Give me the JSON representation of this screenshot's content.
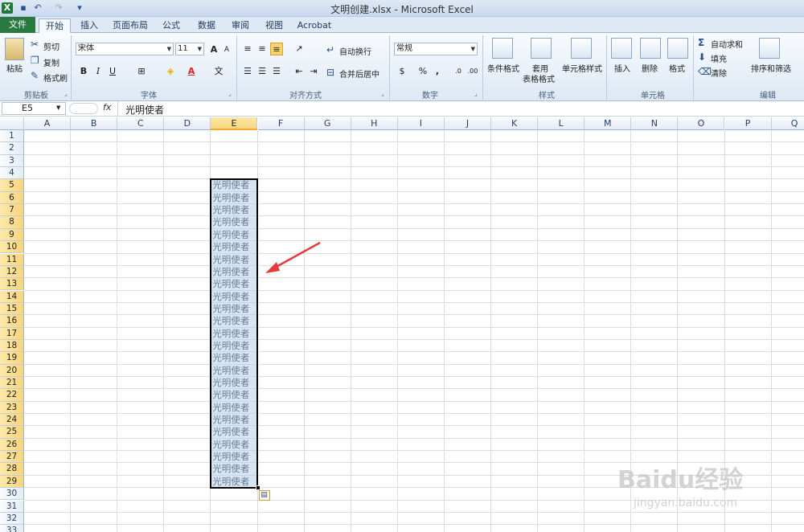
{
  "window": {
    "title": "文明创建.xlsx - Microsoft Excel"
  },
  "tabs": [
    "文件",
    "开始",
    "插入",
    "页面布局",
    "公式",
    "数据",
    "审阅",
    "视图",
    "Acrobat"
  ],
  "ribbon": {
    "clipboard": {
      "paste": "粘贴",
      "cut": "剪切",
      "copy": "复制",
      "format_painter": "格式刷",
      "label": "剪贴板"
    },
    "font": {
      "name": "宋体",
      "size": "11",
      "label": "字体",
      "bold": "B",
      "italic": "I",
      "underline": "U",
      "phonetic": "文"
    },
    "alignment": {
      "wrap": "自动换行",
      "merge": "合并后居中",
      "label": "对齐方式"
    },
    "number": {
      "format": "常规",
      "percent": "%",
      "comma": ",",
      "label": "数字"
    },
    "styles": {
      "conditional": "条件格式",
      "table": "套用\n表格格式",
      "table_line1": "套用",
      "table_line2": "表格格式",
      "cell_styles": "单元格样式",
      "label": "样式"
    },
    "cells": {
      "insert": "插入",
      "delete": "删除",
      "format": "格式",
      "label": "单元格"
    },
    "editing": {
      "autosum": "自动求和",
      "fill": "填充",
      "clear": "清除",
      "sort": "排序和筛选",
      "label": "编辑"
    }
  },
  "formula_bar": {
    "name_box": "E5",
    "fx": "fx",
    "content": "光明使者"
  },
  "columns": [
    "A",
    "B",
    "C",
    "D",
    "E",
    "F",
    "G",
    "H",
    "I",
    "J",
    "K",
    "L",
    "M",
    "N",
    "O",
    "P",
    "Q"
  ],
  "rows": [
    "1",
    "2",
    "3",
    "4",
    "5",
    "6",
    "7",
    "8",
    "9",
    "10",
    "11",
    "12",
    "13",
    "14",
    "15",
    "16",
    "17",
    "18",
    "19",
    "20",
    "21",
    "22",
    "23",
    "24",
    "25",
    "26",
    "27",
    "28",
    "29",
    "30",
    "31",
    "32",
    "33"
  ],
  "selection": {
    "column": "E",
    "first_row": 5,
    "last_row": 29
  },
  "cell_text": "光明使者",
  "watermark": {
    "main": "Baidu经验",
    "sub": "jingyan.baidu.com"
  },
  "colors": {
    "file_tab": "#2a7a3f",
    "selection_fill": "#b4d2f0",
    "arrow": "#e53a3a",
    "header_selected": "#f9d47c"
  }
}
